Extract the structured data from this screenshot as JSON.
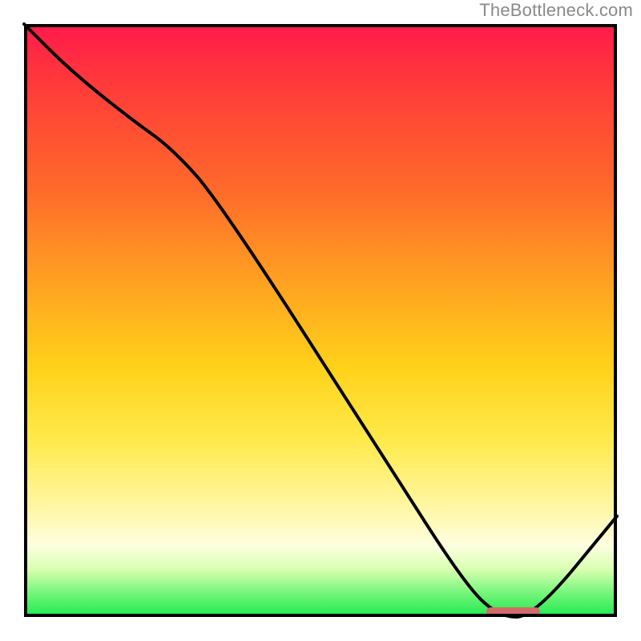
{
  "watermark": "TheBottleneck.com",
  "colors": {
    "top": "#ff1a4b",
    "bottom": "#1eea4e",
    "line": "#000000",
    "marker": "#d46a6a",
    "border": "#000000"
  },
  "chart_data": {
    "type": "line",
    "title": "",
    "xlabel": "",
    "ylabel": "",
    "xlim": [
      0,
      100
    ],
    "ylim": [
      0,
      100
    ],
    "series": [
      {
        "name": "curve",
        "x": [
          0,
          8,
          18,
          25,
          33,
          60,
          74,
          80,
          86,
          100
        ],
        "values": [
          100,
          92,
          84,
          79,
          70,
          28,
          6,
          0,
          0,
          17
        ]
      }
    ],
    "marker": {
      "x_start": 78,
      "x_end": 87,
      "y": 0
    }
  }
}
